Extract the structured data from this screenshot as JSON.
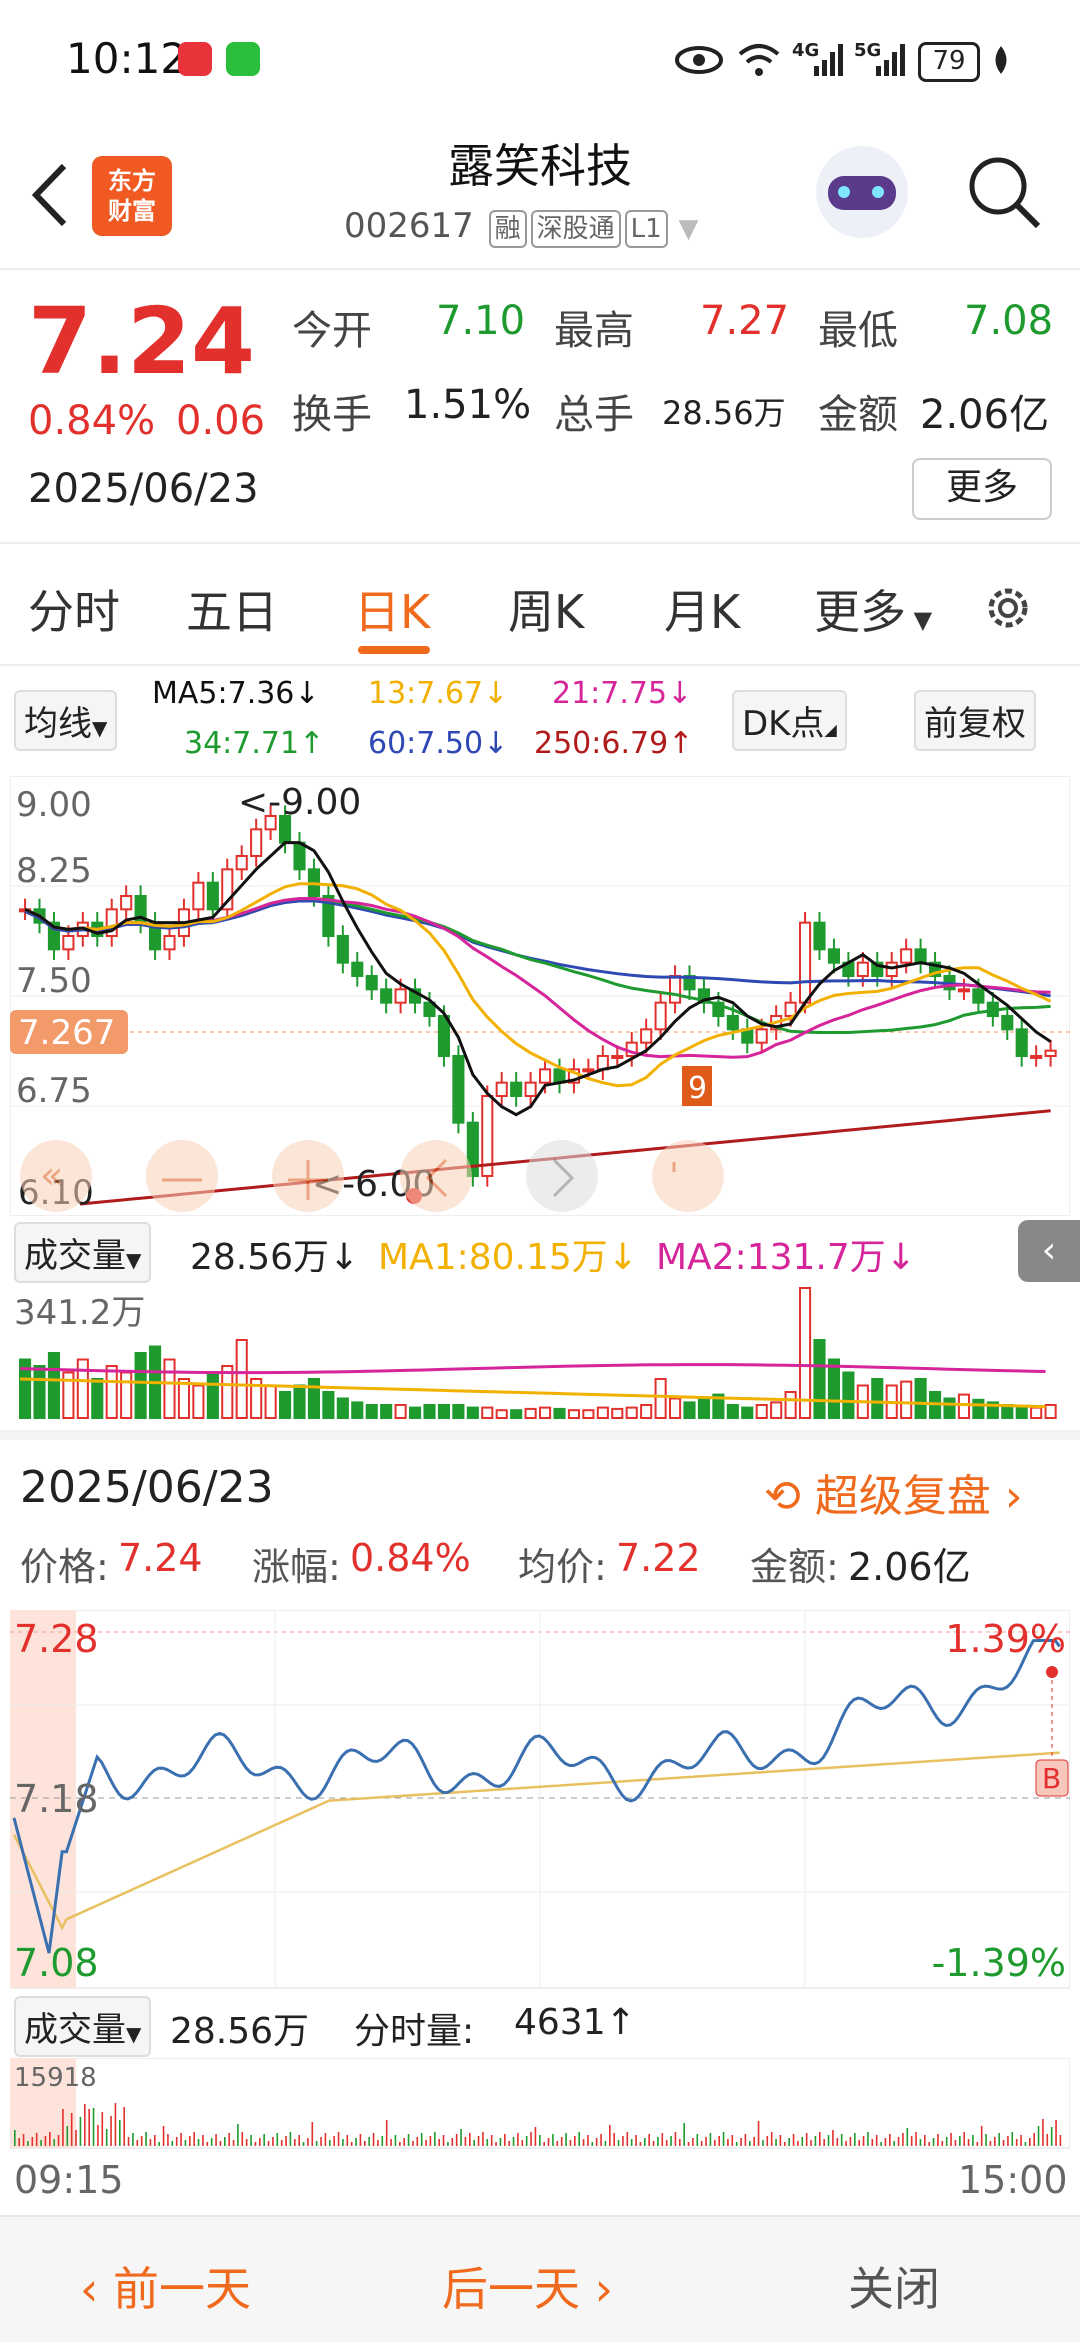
{
  "status_bar": {
    "time": "10:12",
    "network_4g": "4G",
    "network_5g": "5G",
    "battery": "79"
  },
  "header": {
    "logo_text_1": "东方",
    "logo_text_2": "财富",
    "stock_name": "露笑科技",
    "stock_code": "002617",
    "tags": [
      "融",
      "深股通",
      "L1"
    ]
  },
  "quote": {
    "price": "7.24",
    "change_pct": "0.84%",
    "change": "0.06",
    "date": "2025/06/23",
    "open_label": "今开",
    "open": "7.10",
    "high_label": "最高",
    "high": "7.27",
    "low_label": "最低",
    "low": "7.08",
    "turnover_label": "换手",
    "turnover": "1.51%",
    "volume_label": "总手",
    "volume": "28.56万",
    "amount_label": "金额",
    "amount": "2.06亿",
    "more_label": "更多"
  },
  "tabs": {
    "items": [
      "分时",
      "五日",
      "日K",
      "周K",
      "月K",
      "更多"
    ],
    "active": "日K",
    "settings_icon": "gear-icon"
  },
  "ma_legend": {
    "selector": "均线",
    "ma5": "MA5:7.36↓",
    "ma13": "13:7.67↓",
    "ma21": "21:7.75↓",
    "ma34": "34:7.71↑",
    "ma60": "60:7.50↓",
    "ma250": "250:6.79↑",
    "dk_label": "DK点",
    "fq_label": "前复权",
    "colors": {
      "ma5": "#111111",
      "ma13": "#f2b000",
      "ma21": "#d6249a",
      "ma34": "#1e9a2f",
      "ma60": "#2f49b4",
      "ma250": "#b01c1c"
    }
  },
  "kline": {
    "y_labels": [
      "9.00",
      "8.25",
      "7.50",
      "6.75",
      "6.10"
    ],
    "current_price_tag": "7.267",
    "high_marker": "<-9.00",
    "low_marker": "<-6.00",
    "nav_icons": [
      "fast-back-icon",
      "minus-icon",
      "plus-icon",
      "prev-icon",
      "next-icon",
      "expand-icon"
    ],
    "nine_turn_badge": "9"
  },
  "volume_legend": {
    "selector": "成交量",
    "vol": "28.56万↓",
    "ma1": "MA1:80.15万↓",
    "ma2": "MA2:131.7万↓",
    "max_label": "341.2万"
  },
  "detail": {
    "date": "2025/06/23",
    "replay_label": "超级复盘",
    "price_label": "价格:",
    "price": "7.24",
    "chg_label": "涨幅:",
    "chg": "0.84%",
    "avg_label": "均价:",
    "avg": "7.22",
    "amount_label": "金额:",
    "amount": "2.06亿"
  },
  "intraday": {
    "y_top": "7.28",
    "y_mid": "7.18",
    "y_bottom": "7.08",
    "pct_top": "1.39%",
    "pct_bottom": "-1.39%",
    "b_marker": "B",
    "vol_selector": "成交量",
    "vol": "28.56万",
    "tick_vol_label": "分时量:",
    "tick_vol": "4631↑",
    "vol_max": "15918",
    "time_start": "09:15",
    "time_end": "15:00"
  },
  "bottom_bar": {
    "prev": "前一天",
    "next": "后一天",
    "close": "关闭"
  }
}
